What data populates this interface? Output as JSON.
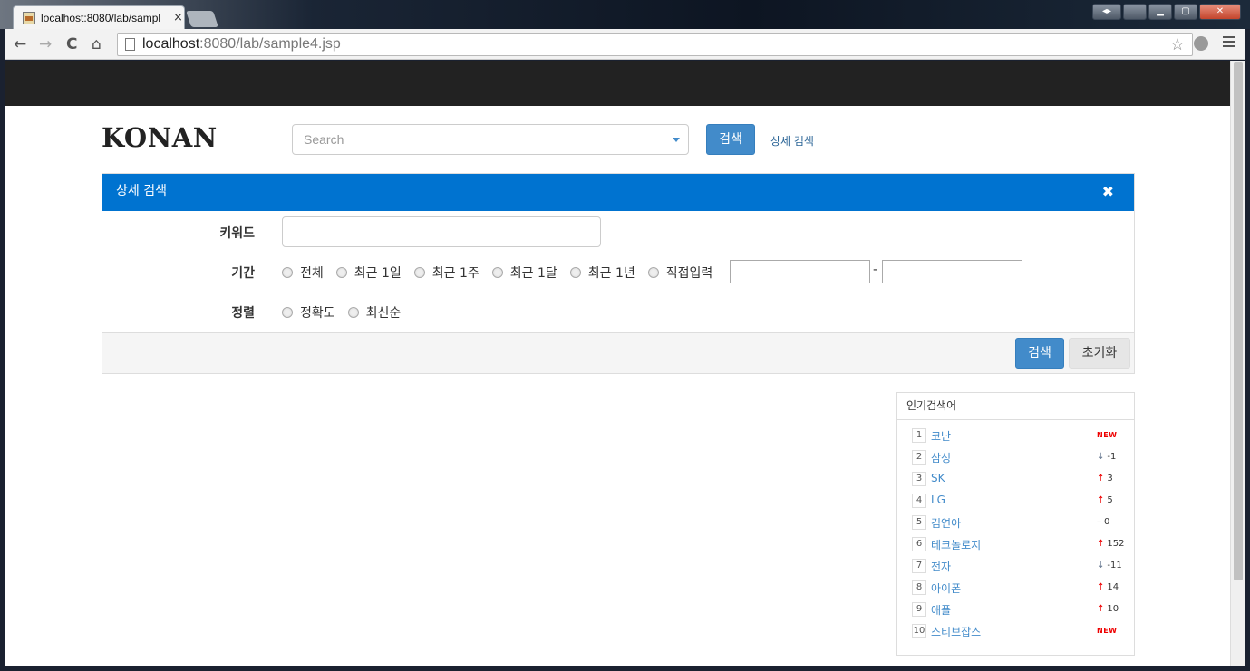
{
  "browser": {
    "tab_title": "localhost:8080/lab/sampl",
    "tab_close": "×",
    "url_host": "localhost",
    "url_rest": ":8080/lab/sample4.jsp",
    "nav_back": "←",
    "nav_forward": "→",
    "nav_reload": "C",
    "nav_home": "⌂",
    "star": "☆",
    "win_min": "▁",
    "win_max": "▢",
    "win_close": "✕",
    "win_extra": "◂▸"
  },
  "header": {
    "logo": "KONAN",
    "search_placeholder": "Search",
    "search_button": "검색",
    "advanced_link": "상세 검색"
  },
  "advanced_panel": {
    "title": "상세 검색",
    "close_icon": "✖",
    "keyword_label": "키워드",
    "period_label": "기간",
    "period_options": [
      "전체",
      "최근 1일",
      "최근 1주",
      "최근 1달",
      "최근 1년",
      "직접입력"
    ],
    "date_separator": "-",
    "sort_label": "정렬",
    "sort_options": [
      "정확도",
      "최신순"
    ],
    "search_button": "검색",
    "reset_button": "초기화"
  },
  "popular": {
    "title": "인기검색어",
    "items": [
      {
        "rank": "1",
        "word": "코난",
        "dir": "new",
        "change": "NEW"
      },
      {
        "rank": "2",
        "word": "삼성",
        "dir": "down",
        "change": "-1"
      },
      {
        "rank": "3",
        "word": "SK",
        "dir": "up",
        "change": "3"
      },
      {
        "rank": "4",
        "word": "LG",
        "dir": "up",
        "change": "5"
      },
      {
        "rank": "5",
        "word": "김연아",
        "dir": "same",
        "change": "0"
      },
      {
        "rank": "6",
        "word": "테크놀로지",
        "dir": "up",
        "change": "152"
      },
      {
        "rank": "7",
        "word": "전자",
        "dir": "down",
        "change": "-11"
      },
      {
        "rank": "8",
        "word": "아이폰",
        "dir": "up",
        "change": "14"
      },
      {
        "rank": "9",
        "word": "애플",
        "dir": "up",
        "change": "10"
      },
      {
        "rank": "10",
        "word": "스티브잡스",
        "dir": "new",
        "change": "NEW"
      }
    ]
  }
}
